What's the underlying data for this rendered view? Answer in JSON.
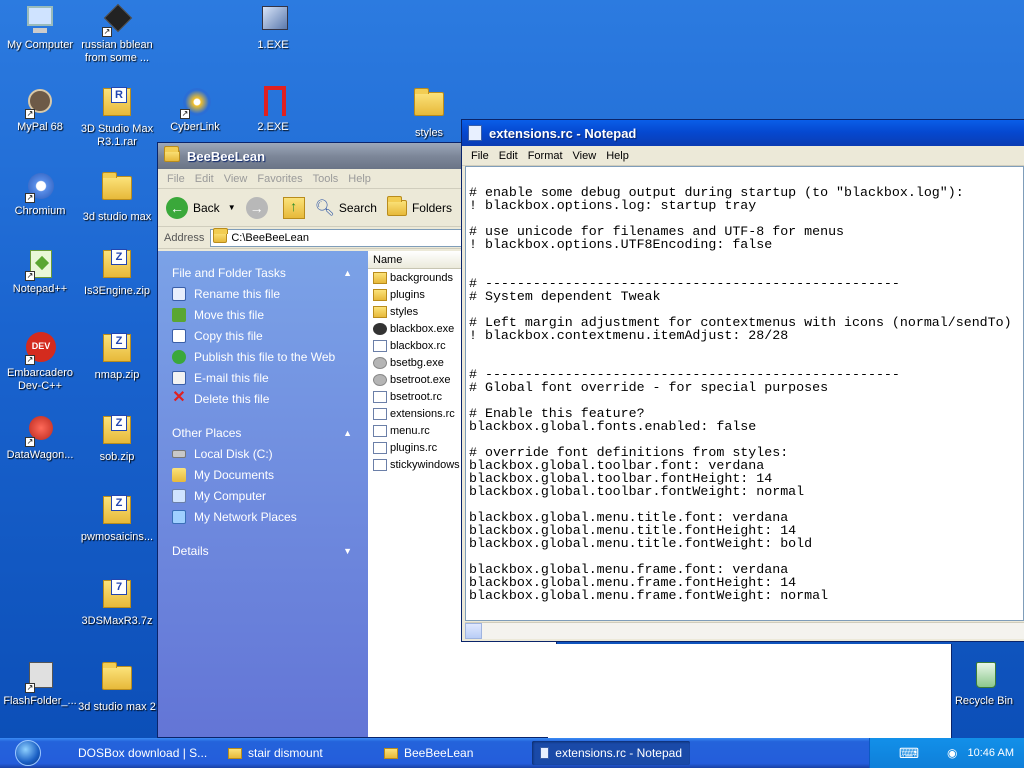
{
  "desktop": {
    "icons": [
      {
        "label": "My Computer"
      },
      {
        "label": "russian bblean from some ..."
      },
      {
        "label": "1.EXE"
      },
      {
        "label": "MyPal 68"
      },
      {
        "label": "3D Studio Max R3.1.rar"
      },
      {
        "label": "CyberLink Power DVD 9"
      },
      {
        "label": "2.EXE"
      },
      {
        "label": "styles"
      },
      {
        "label": "Chromium"
      },
      {
        "label": "3d studio max"
      },
      {
        "label": "Notepad++"
      },
      {
        "label": "Is3Engine.zip"
      },
      {
        "label": "Embarcadero Dev-C++"
      },
      {
        "label": "nmap.zip"
      },
      {
        "label": "DataWagon..."
      },
      {
        "label": "sob.zip"
      },
      {
        "label": "pwmosaicins..."
      },
      {
        "label": "3DSMaxR3.7z"
      },
      {
        "label": "FlashFolder_..."
      },
      {
        "label": "3d studio max 2"
      },
      {
        "label": "Recycle Bin"
      }
    ]
  },
  "explorer": {
    "title": "BeeBeeLean",
    "menu": [
      "File",
      "Edit",
      "View",
      "Favorites",
      "Tools",
      "Help"
    ],
    "toolbar": {
      "back": "Back",
      "search": "Search",
      "folders": "Folders"
    },
    "address_label": "Address",
    "address_value": "C:\\BeeBeeLean",
    "file_tasks": {
      "heading": "File and Folder Tasks",
      "items": [
        "Rename this file",
        "Move this file",
        "Copy this file",
        "Publish this file to the Web",
        "E-mail this file",
        "Delete this file"
      ]
    },
    "other_places": {
      "heading": "Other Places",
      "items": [
        "Local Disk (C:)",
        "My Documents",
        "My Computer",
        "My Network Places"
      ]
    },
    "details_heading": "Details",
    "column_name": "Name",
    "files": [
      {
        "name": "backgrounds",
        "type": "folder"
      },
      {
        "name": "plugins",
        "type": "folder"
      },
      {
        "name": "styles",
        "type": "folder"
      },
      {
        "name": "blackbox.exe",
        "type": "exe"
      },
      {
        "name": "blackbox.rc",
        "type": "doc"
      },
      {
        "name": "bsetbg.exe",
        "type": "gear"
      },
      {
        "name": "bsetroot.exe",
        "type": "gear"
      },
      {
        "name": "bsetroot.rc",
        "type": "doc"
      },
      {
        "name": "extensions.rc",
        "type": "doc"
      },
      {
        "name": "menu.rc",
        "type": "doc"
      },
      {
        "name": "plugins.rc",
        "type": "doc"
      },
      {
        "name": "stickywindows",
        "type": "doc"
      }
    ]
  },
  "notepad": {
    "title": "extensions.rc - Notepad",
    "menu": [
      "File",
      "Edit",
      "Format",
      "View",
      "Help"
    ],
    "content": "\n# enable some debug output during startup (to \"blackbox.log\"):\n! blackbox.options.log: startup tray\n\n# use unicode for filenames and UTF-8 for menus\n! blackbox.options.UTF8Encoding: false\n\n\n# ----------------------------------------------------\n# System dependent Tweak\n\n# Left margin adjustment for contextmenus with icons (normal/sendTo)\n! blackbox.contextmenu.itemAdjust: 28/28\n\n\n# ----------------------------------------------------\n# Global font override - for special purposes\n\n# Enable this feature?\nblackbox.global.fonts.enabled: false\n\n# override font definitions from styles:\nblackbox.global.toolbar.font: verdana\nblackbox.global.toolbar.fontHeight: 14\nblackbox.global.toolbar.fontWeight: normal\n\nblackbox.global.menu.title.font: verdana\nblackbox.global.menu.title.fontHeight: 14\nblackbox.global.menu.title.fontWeight: bold\n\nblackbox.global.menu.frame.font: verdana\nblackbox.global.menu.frame.fontHeight: 14\nblackbox.global.menu.frame.fontWeight: normal"
  },
  "taskbar": {
    "tasks": [
      "DOSBox download | S...",
      "stair dismount",
      "BeeBeeLean",
      "extensions.rc - Notepad"
    ],
    "clock": "10:46 AM"
  }
}
